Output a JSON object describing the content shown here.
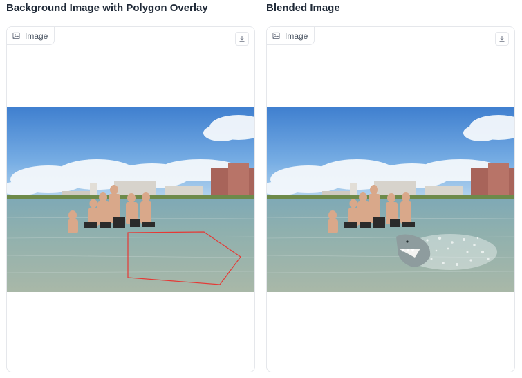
{
  "left_panel": {
    "heading": "Background Image with Polygon Overlay",
    "label": "Image",
    "label_icon": "image-icon",
    "download_icon": "download-icon"
  },
  "right_panel": {
    "heading": "Blended Image",
    "label": "Image",
    "label_icon": "image-icon",
    "download_icon": "download-icon"
  },
  "colors": {
    "polygon_stroke": "#e53935",
    "panel_border": "#e5e7eb",
    "heading_text": "#1f2937"
  }
}
